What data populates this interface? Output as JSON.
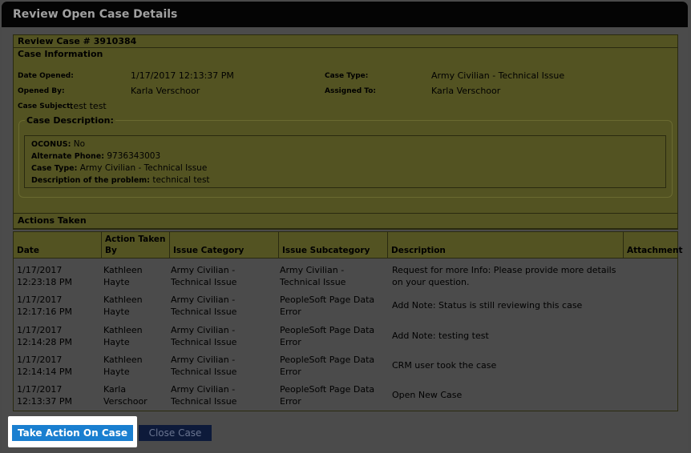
{
  "dialog": {
    "title": "Review Open Case Details"
  },
  "review": {
    "case_header": "Review Case # 3910384",
    "info_header": "Case Information",
    "date_opened_label": "Date Opened:",
    "date_opened_value": "1/17/2017 12:13:37 PM",
    "case_type_label": "Case Type:",
    "case_type_value": "Army Civilian - Technical Issue",
    "opened_by_label": "Opened By:",
    "opened_by_value": "Karla Verschoor",
    "assigned_to_label": "Assigned To:",
    "assigned_to_value": "Karla Verschoor",
    "subject_label": "Case Subject:",
    "subject_value": "test test",
    "description_legend": "Case Description:",
    "description_lines": [
      {
        "label": "OCONUS:",
        "value": "No"
      },
      {
        "label": "Alternate Phone:",
        "value": "9736343003"
      },
      {
        "label": "Case Type:",
        "value": "Army Civilian - Technical Issue"
      },
      {
        "label": "Description of the problem:",
        "value": "technical test"
      }
    ]
  },
  "actions": {
    "header": "Actions Taken",
    "columns": [
      "Date",
      "Action Taken By",
      "Issue Category",
      "Issue Subcategory",
      "Description",
      "Attachment"
    ],
    "rows": [
      {
        "date": "1/17/2017 12:23:18 PM",
        "by": "Kathleen Hayte",
        "category": "Army Civilian - Technical Issue",
        "subcategory": "Army Civilian - Technical Issue",
        "description": "Request for more Info: Please provide more details on your question.",
        "attachment": ""
      },
      {
        "date": "1/17/2017 12:17:16 PM",
        "by": "Kathleen Hayte",
        "category": "Army Civilian - Technical Issue",
        "subcategory": "PeopleSoft Page Data Error",
        "description": "Add Note: Status is still reviewing this case",
        "attachment": ""
      },
      {
        "date": "1/17/2017 12:14:28 PM",
        "by": "Kathleen Hayte",
        "category": "Army Civilian - Technical Issue",
        "subcategory": "PeopleSoft Page Data Error",
        "description": "Add Note: testing test",
        "attachment": ""
      },
      {
        "date": "1/17/2017 12:14:14 PM",
        "by": "Kathleen Hayte",
        "category": "Army Civilian - Technical Issue",
        "subcategory": "PeopleSoft Page Data Error",
        "description": "CRM user took the case",
        "attachment": ""
      },
      {
        "date": "1/17/2017 12:13:37 PM",
        "by": "Karla Verschoor",
        "category": "Army Civilian - Technical Issue",
        "subcategory": "PeopleSoft Page Data Error",
        "description": "Open New Case",
        "attachment": ""
      }
    ]
  },
  "buttons": {
    "take_action": "Take Action On Case",
    "close_case": "Close Case"
  },
  "colors": {
    "primary_button": "#1a7fd0",
    "highlight": "#ffffff",
    "panel_overlay": "#535322"
  }
}
